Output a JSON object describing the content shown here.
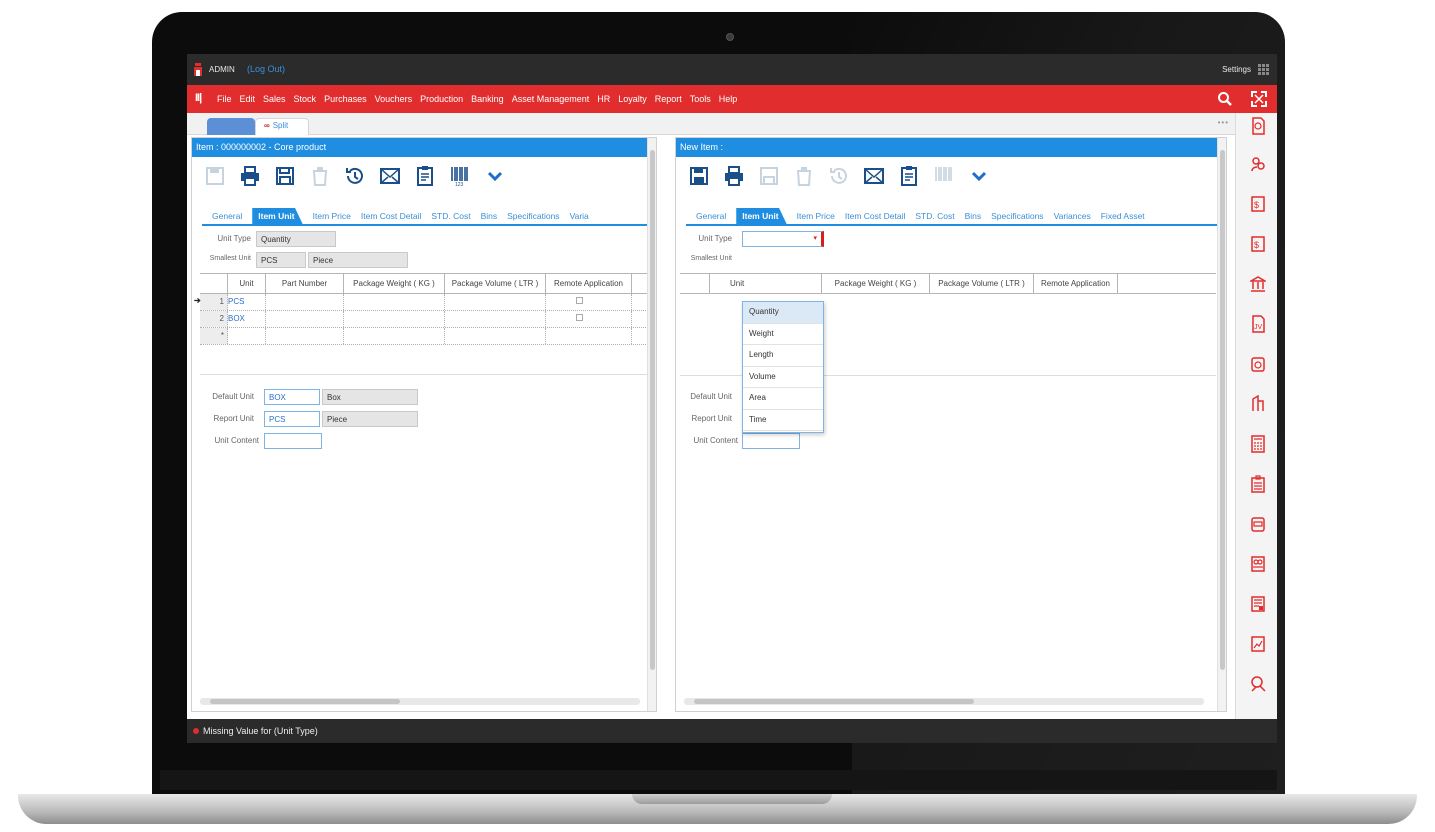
{
  "topbar": {
    "user": "ADMIN",
    "logout": "(Log Out)",
    "settings": "Settings"
  },
  "menu": [
    "File",
    "Edit",
    "Sales",
    "Stock",
    "Purchases",
    "Vouchers",
    "Production",
    "Banking",
    "Asset Management",
    "HR",
    "Loyalty",
    "Report",
    "Tools",
    "Help"
  ],
  "tabstrip": {
    "split_label": "Split",
    "more": "•••"
  },
  "left_panel": {
    "title": "Item : 000000002 - Core product",
    "tabs": [
      "General",
      "Item Unit",
      "Item Price",
      "Item Cost Detail",
      "STD. Cost",
      "Bins",
      "Specifications",
      "Varia"
    ],
    "active_tab": "Item Unit",
    "unit_type_label": "Unit Type",
    "unit_type_value": "Quantity",
    "smallest_unit_label": "Smallest Unit",
    "smallest_unit_code": "PCS",
    "smallest_unit_name": "Piece",
    "columns": [
      "Unit",
      "Part Number",
      "Package Weight ( KG )",
      "Package Volume ( LTR )",
      "Remote Application"
    ],
    "rows": [
      {
        "n": "1",
        "unit": "PCS"
      },
      {
        "n": "2",
        "unit": "BOX"
      },
      {
        "n": "*",
        "unit": ""
      }
    ],
    "default_unit_label": "Default Unit",
    "default_unit_code": "BOX",
    "default_unit_name": "Box",
    "report_unit_label": "Report Unit",
    "report_unit_code": "PCS",
    "report_unit_name": "Piece",
    "unit_content_label": "Unit Content"
  },
  "right_panel": {
    "title": "New Item :",
    "tabs": [
      "General",
      "Item Unit",
      "Item Price",
      "Item Cost Detail",
      "STD. Cost",
      "Bins",
      "Specifications",
      "Variances",
      "Fixed Asset"
    ],
    "active_tab": "Item Unit",
    "unit_type_label": "Unit Type",
    "smallest_unit_label": "Smallest Unit",
    "columns": [
      "Unit",
      "Package Weight ( KG )",
      "Package Volume ( LTR )",
      "Remote Application"
    ],
    "default_unit_label": "Default Unit",
    "report_unit_label": "Report Unit",
    "unit_content_label": "Unit Content",
    "dropdown_options": [
      "Quantity",
      "Weight",
      "Length",
      "Volume",
      "Area",
      "Time"
    ]
  },
  "status": {
    "message": "Missing Value for (Unit Type)"
  },
  "colors": {
    "brand_red": "#e12d2d",
    "header_blue": "#1f8de0",
    "dark_bar": "#2b2b2b"
  }
}
